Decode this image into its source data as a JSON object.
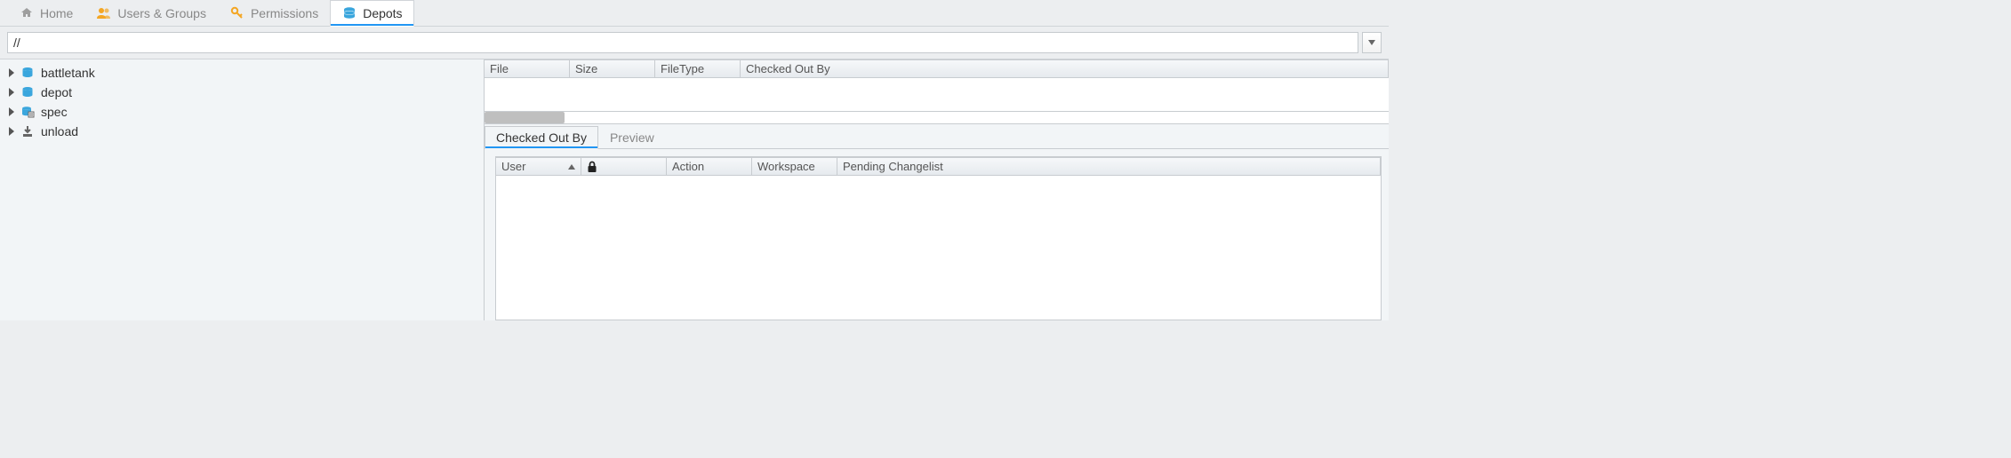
{
  "tabs": [
    {
      "label": "Home",
      "active": false
    },
    {
      "label": "Users & Groups",
      "active": false
    },
    {
      "label": "Permissions",
      "active": false
    },
    {
      "label": "Depots",
      "active": true
    }
  ],
  "path_input_value": "//",
  "tree": [
    {
      "label": "battletank",
      "icon": "db"
    },
    {
      "label": "depot",
      "icon": "db"
    },
    {
      "label": "spec",
      "icon": "spec"
    },
    {
      "label": "unload",
      "icon": "unload"
    }
  ],
  "upper_cols": {
    "file": "File",
    "size": "Size",
    "filetype": "FileType",
    "checkedout": "Checked Out By"
  },
  "sub_tabs": [
    {
      "label": "Checked Out By",
      "active": true
    },
    {
      "label": "Preview",
      "active": false
    }
  ],
  "lower_cols": {
    "user": "User",
    "lock": "",
    "action": "Action",
    "workspace": "Workspace",
    "pending": "Pending Changelist"
  }
}
